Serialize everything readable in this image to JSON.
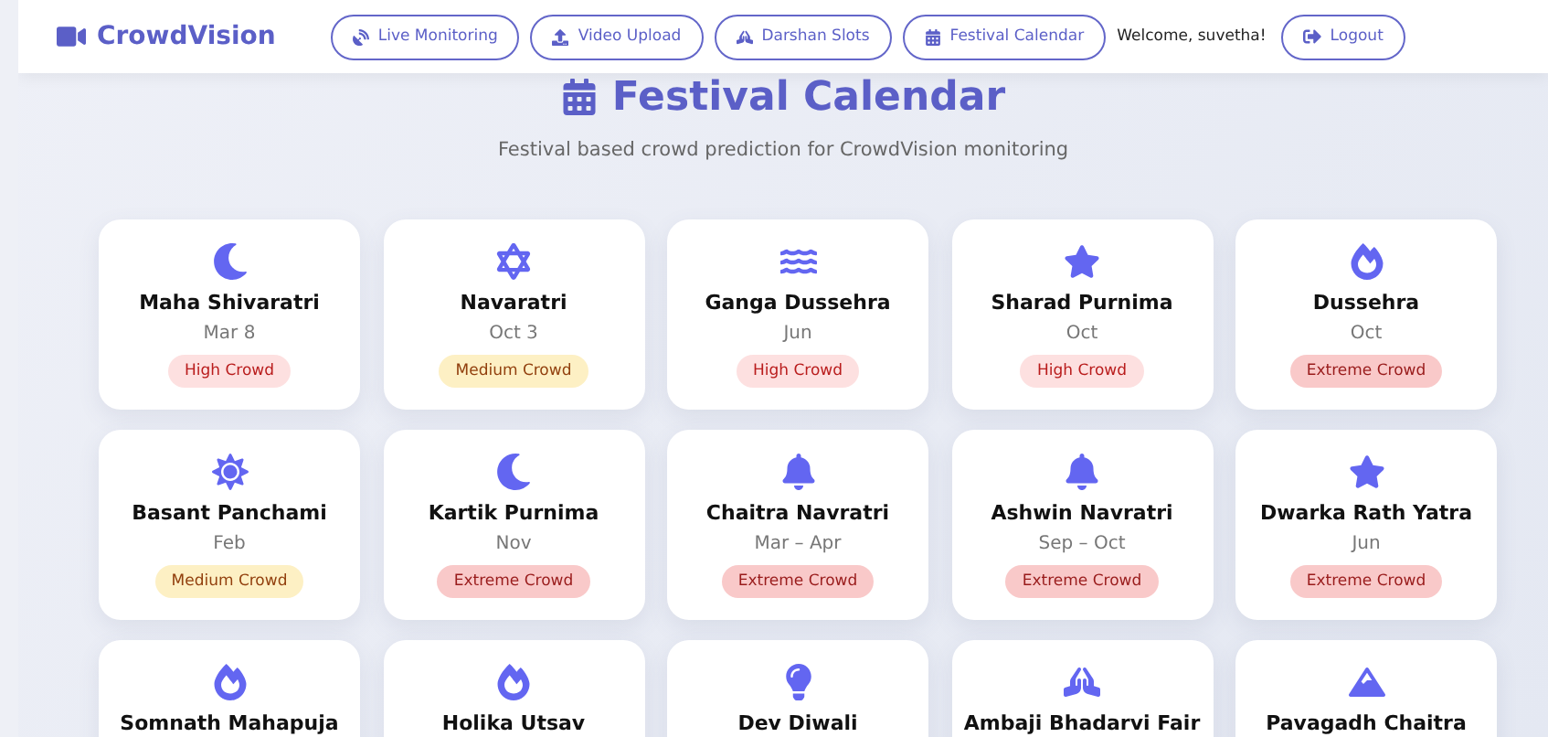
{
  "brand": "CrowdVision",
  "nav": [
    {
      "label": "Live Monitoring",
      "kind": "dish"
    },
    {
      "label": "Video Upload",
      "kind": "upload"
    },
    {
      "label": "Darshan Slots",
      "kind": "hands"
    },
    {
      "label": "Festival Calendar",
      "kind": "calendar"
    }
  ],
  "welcome": "Welcome, suvetha!",
  "logout": "Logout",
  "title": "Festival Calendar",
  "subtitle": "Festival based crowd prediction for CrowdVision monitoring",
  "festivals": [
    {
      "name": "Maha Shivaratri",
      "date": "Mar 8",
      "kind": "moon",
      "crowd": {
        "label": "High Crowd",
        "kind": "high"
      }
    },
    {
      "name": "Navaratri",
      "date": "Oct 3",
      "kind": "hexagram",
      "crowd": {
        "label": "Medium Crowd",
        "kind": "medium"
      }
    },
    {
      "name": "Ganga Dussehra",
      "date": "Jun",
      "kind": "water",
      "crowd": {
        "label": "High Crowd",
        "kind": "high"
      }
    },
    {
      "name": "Sharad Purnima",
      "date": "Oct",
      "kind": "star",
      "crowd": {
        "label": "High Crowd",
        "kind": "high"
      }
    },
    {
      "name": "Dussehra",
      "date": "Oct",
      "kind": "fire",
      "crowd": {
        "label": "Extreme Crowd",
        "kind": "extreme"
      }
    },
    {
      "name": "Basant Panchami",
      "date": "Feb",
      "kind": "sun",
      "crowd": {
        "label": "Medium Crowd",
        "kind": "medium"
      }
    },
    {
      "name": "Kartik Purnima",
      "date": "Nov",
      "kind": "moon",
      "crowd": {
        "label": "Extreme Crowd",
        "kind": "extreme"
      }
    },
    {
      "name": "Chaitra Navratri",
      "date": "Mar – Apr",
      "kind": "bell",
      "crowd": {
        "label": "Extreme Crowd",
        "kind": "extreme"
      }
    },
    {
      "name": "Ashwin Navratri",
      "date": "Sep – Oct",
      "kind": "bell",
      "crowd": {
        "label": "Extreme Crowd",
        "kind": "extreme"
      }
    },
    {
      "name": "Dwarka Rath Yatra",
      "date": "Jun",
      "kind": "star",
      "crowd": {
        "label": "Extreme Crowd",
        "kind": "extreme"
      }
    },
    {
      "name": "Somnath Mahapuja",
      "kind": "fire"
    },
    {
      "name": "Holika Utsav",
      "kind": "fire"
    },
    {
      "name": "Dev Diwali",
      "kind": "bulb"
    },
    {
      "name": "Ambaji Bhadarvi Fair",
      "kind": "hands"
    },
    {
      "name": "Pavagadh Chaitra",
      "kind": "mountain"
    }
  ]
}
